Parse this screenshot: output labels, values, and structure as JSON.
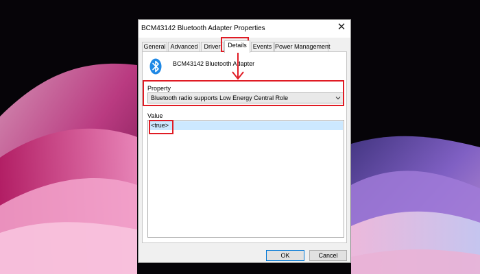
{
  "dialog": {
    "title": "BCM43142 Bluetooth Adapter Properties",
    "close_symbol": "✕",
    "tabs": [
      {
        "label": "General",
        "active": false
      },
      {
        "label": "Advanced",
        "active": false
      },
      {
        "label": "Driver",
        "active": false
      },
      {
        "label": "Details",
        "active": true
      },
      {
        "label": "Events",
        "active": false
      },
      {
        "label": "Power Management",
        "active": false
      }
    ],
    "device_name": "BCM43142 Bluetooth Adapter",
    "device_icon": "bluetooth-icon",
    "property_label": "Property",
    "property_value": "Bluetooth radio supports Low Energy Central Role",
    "value_label": "Value",
    "value_items": [
      "<true>"
    ],
    "ok_label": "OK",
    "cancel_label": "Cancel"
  },
  "annotations": {
    "color": "#e01b24"
  },
  "colors": {
    "accent": "#0078d7",
    "bluetooth": "#1e88e5",
    "selection": "#cce8ff"
  }
}
